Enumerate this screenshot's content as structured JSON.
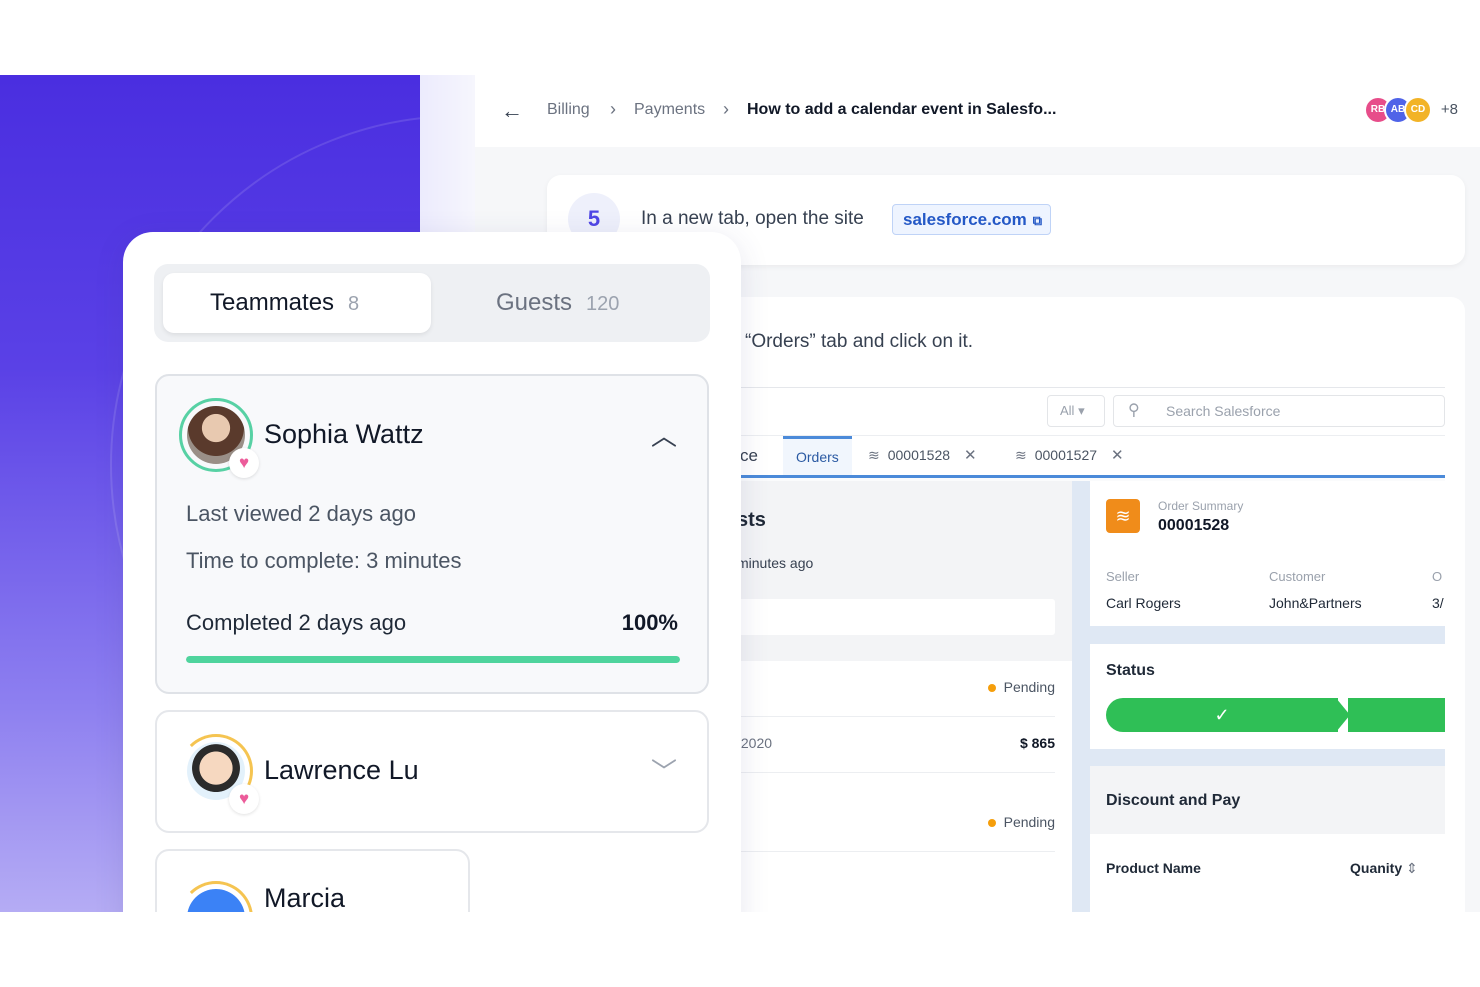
{
  "breadcrumb": {
    "items": [
      "Billing",
      "Payments"
    ],
    "current": "How to add a calendar event in Salesfo..."
  },
  "collaborators": {
    "avatars": [
      {
        "initials": "RB",
        "color": "#e74d8a"
      },
      {
        "initials": "AB",
        "color": "#4f63e8"
      },
      {
        "initials": "CD",
        "color": "#f2b327"
      }
    ],
    "more": "+8"
  },
  "step": {
    "number": "5",
    "text": "In a new tab, open the site",
    "link": "salesforce.com"
  },
  "next_step": {
    "text": "“Orders” tab and click on it."
  },
  "salesforce": {
    "filter": "All",
    "search_placeholder": "Search Salesforce",
    "tabs": [
      {
        "label": "ce"
      },
      {
        "label": "Orders",
        "active": true
      },
      {
        "label": "00001528",
        "closable": true
      },
      {
        "label": "00001527",
        "closable": true
      }
    ],
    "left": {
      "title": "sts",
      "subtitle": "minutes ago",
      "rows": [
        {
          "status": "Pending"
        },
        {
          "date": "/2020",
          "amount": "$ 865"
        },
        {
          "status": "Pending"
        }
      ]
    },
    "order_summary": {
      "label": "Order Summary",
      "number": "00001528",
      "fields": [
        {
          "label": "Seller",
          "value": "Carl Rogers"
        },
        {
          "label": "Customer",
          "value": "John&Partners"
        },
        {
          "label": "O",
          "value": "3/"
        }
      ]
    },
    "status": {
      "label": "Status",
      "check": "✓"
    },
    "discount": {
      "title": "Discount and Pay",
      "columns": [
        "Product Name",
        "Quanity"
      ]
    }
  },
  "team_panel": {
    "tabs": [
      {
        "label": "Teammates",
        "count": "8",
        "active": true
      },
      {
        "label": "Guests",
        "count": "120",
        "active": false
      }
    ],
    "people": [
      {
        "name": "Sophia Wattz",
        "expanded": true,
        "last_viewed": "Last viewed 2 days ago",
        "time_to_complete": "Time to complete: 3 minutes",
        "completed": "Completed 2 days ago",
        "percent": "100%",
        "progress": 1.0
      },
      {
        "name": "Lawrence Lu",
        "expanded": false
      },
      {
        "name": "Marcia",
        "expanded": false
      }
    ]
  },
  "colors": {
    "accent": "#4f46e5",
    "progress": "#4fd49d",
    "status_green": "#2fbf56",
    "heart": "#ec5c9a"
  }
}
